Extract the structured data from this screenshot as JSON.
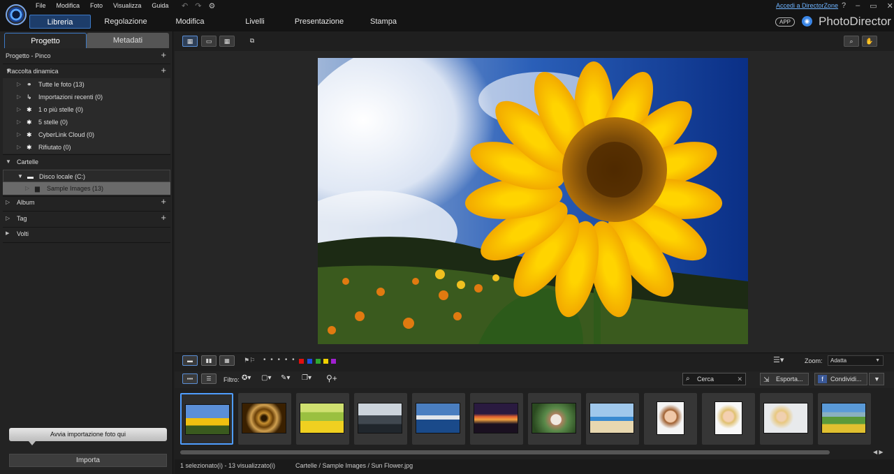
{
  "menubar": {
    "items": [
      "File",
      "Modifica",
      "Foto",
      "Visualizza",
      "Guida"
    ],
    "accedi": "Accedi a DirectorZone",
    "help": "?"
  },
  "modules": {
    "tabs": [
      "Libreria",
      "Regolazione",
      "Modifica",
      "Livelli",
      "Presentazione",
      "Stampa"
    ],
    "active": "Libreria",
    "app_badge": "APP",
    "product": "PhotoDirector"
  },
  "left_panel": {
    "tabs": [
      "Progetto",
      "Metadati"
    ],
    "project": "Progetto - Pinco",
    "smart_collection": "Raccolta dinamica",
    "smart_items": [
      "Tutte le foto (13)",
      "Importazioni recenti (0)",
      "1 o più stelle (0)",
      "5 stelle (0)",
      "CyberLink Cloud (0)",
      "Rifiutato (0)"
    ],
    "folders": "Cartelle",
    "drive": "Disco locale (C:)",
    "sample_folder": "Sample Images (13)",
    "album": "Album",
    "tag": "Tag",
    "faces": "Volti",
    "import_hint": "Avvia importazione foto qui",
    "import_button": "Importa"
  },
  "filmstrip_bar": {
    "filter_label": "Filtro:",
    "zoom_label": "Zoom:",
    "zoom_value": "Adatta",
    "search_placeholder": "Cerca",
    "export_label": "Esporta...",
    "share_label": "Condividi...",
    "color_labels": [
      "#e01010",
      "#1f4de0",
      "#2fa82f",
      "#f0d000",
      "#a020d0"
    ]
  },
  "status": {
    "selection": "1 selezionato(i) - 13 visualizzato(i)",
    "path": "Cartelle / Sample Images / Sun Flower.jpg"
  }
}
